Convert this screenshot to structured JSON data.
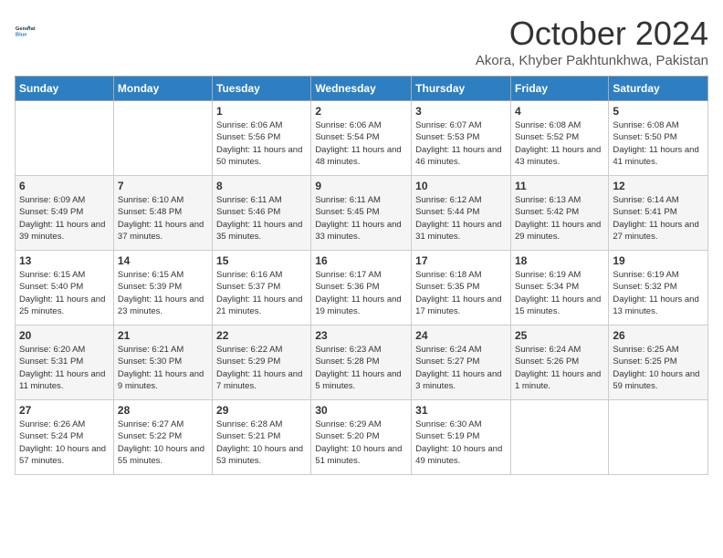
{
  "header": {
    "logo_line1": "General",
    "logo_line2": "Blue",
    "month": "October 2024",
    "location": "Akora, Khyber Pakhtunkhwa, Pakistan"
  },
  "days_of_week": [
    "Sunday",
    "Monday",
    "Tuesday",
    "Wednesday",
    "Thursday",
    "Friday",
    "Saturday"
  ],
  "weeks": [
    [
      {
        "day": "",
        "sunrise": "",
        "sunset": "",
        "daylight": ""
      },
      {
        "day": "",
        "sunrise": "",
        "sunset": "",
        "daylight": ""
      },
      {
        "day": "1",
        "sunrise": "Sunrise: 6:06 AM",
        "sunset": "Sunset: 5:56 PM",
        "daylight": "Daylight: 11 hours and 50 minutes."
      },
      {
        "day": "2",
        "sunrise": "Sunrise: 6:06 AM",
        "sunset": "Sunset: 5:54 PM",
        "daylight": "Daylight: 11 hours and 48 minutes."
      },
      {
        "day": "3",
        "sunrise": "Sunrise: 6:07 AM",
        "sunset": "Sunset: 5:53 PM",
        "daylight": "Daylight: 11 hours and 46 minutes."
      },
      {
        "day": "4",
        "sunrise": "Sunrise: 6:08 AM",
        "sunset": "Sunset: 5:52 PM",
        "daylight": "Daylight: 11 hours and 43 minutes."
      },
      {
        "day": "5",
        "sunrise": "Sunrise: 6:08 AM",
        "sunset": "Sunset: 5:50 PM",
        "daylight": "Daylight: 11 hours and 41 minutes."
      }
    ],
    [
      {
        "day": "6",
        "sunrise": "Sunrise: 6:09 AM",
        "sunset": "Sunset: 5:49 PM",
        "daylight": "Daylight: 11 hours and 39 minutes."
      },
      {
        "day": "7",
        "sunrise": "Sunrise: 6:10 AM",
        "sunset": "Sunset: 5:48 PM",
        "daylight": "Daylight: 11 hours and 37 minutes."
      },
      {
        "day": "8",
        "sunrise": "Sunrise: 6:11 AM",
        "sunset": "Sunset: 5:46 PM",
        "daylight": "Daylight: 11 hours and 35 minutes."
      },
      {
        "day": "9",
        "sunrise": "Sunrise: 6:11 AM",
        "sunset": "Sunset: 5:45 PM",
        "daylight": "Daylight: 11 hours and 33 minutes."
      },
      {
        "day": "10",
        "sunrise": "Sunrise: 6:12 AM",
        "sunset": "Sunset: 5:44 PM",
        "daylight": "Daylight: 11 hours and 31 minutes."
      },
      {
        "day": "11",
        "sunrise": "Sunrise: 6:13 AM",
        "sunset": "Sunset: 5:42 PM",
        "daylight": "Daylight: 11 hours and 29 minutes."
      },
      {
        "day": "12",
        "sunrise": "Sunrise: 6:14 AM",
        "sunset": "Sunset: 5:41 PM",
        "daylight": "Daylight: 11 hours and 27 minutes."
      }
    ],
    [
      {
        "day": "13",
        "sunrise": "Sunrise: 6:15 AM",
        "sunset": "Sunset: 5:40 PM",
        "daylight": "Daylight: 11 hours and 25 minutes."
      },
      {
        "day": "14",
        "sunrise": "Sunrise: 6:15 AM",
        "sunset": "Sunset: 5:39 PM",
        "daylight": "Daylight: 11 hours and 23 minutes."
      },
      {
        "day": "15",
        "sunrise": "Sunrise: 6:16 AM",
        "sunset": "Sunset: 5:37 PM",
        "daylight": "Daylight: 11 hours and 21 minutes."
      },
      {
        "day": "16",
        "sunrise": "Sunrise: 6:17 AM",
        "sunset": "Sunset: 5:36 PM",
        "daylight": "Daylight: 11 hours and 19 minutes."
      },
      {
        "day": "17",
        "sunrise": "Sunrise: 6:18 AM",
        "sunset": "Sunset: 5:35 PM",
        "daylight": "Daylight: 11 hours and 17 minutes."
      },
      {
        "day": "18",
        "sunrise": "Sunrise: 6:19 AM",
        "sunset": "Sunset: 5:34 PM",
        "daylight": "Daylight: 11 hours and 15 minutes."
      },
      {
        "day": "19",
        "sunrise": "Sunrise: 6:19 AM",
        "sunset": "Sunset: 5:32 PM",
        "daylight": "Daylight: 11 hours and 13 minutes."
      }
    ],
    [
      {
        "day": "20",
        "sunrise": "Sunrise: 6:20 AM",
        "sunset": "Sunset: 5:31 PM",
        "daylight": "Daylight: 11 hours and 11 minutes."
      },
      {
        "day": "21",
        "sunrise": "Sunrise: 6:21 AM",
        "sunset": "Sunset: 5:30 PM",
        "daylight": "Daylight: 11 hours and 9 minutes."
      },
      {
        "day": "22",
        "sunrise": "Sunrise: 6:22 AM",
        "sunset": "Sunset: 5:29 PM",
        "daylight": "Daylight: 11 hours and 7 minutes."
      },
      {
        "day": "23",
        "sunrise": "Sunrise: 6:23 AM",
        "sunset": "Sunset: 5:28 PM",
        "daylight": "Daylight: 11 hours and 5 minutes."
      },
      {
        "day": "24",
        "sunrise": "Sunrise: 6:24 AM",
        "sunset": "Sunset: 5:27 PM",
        "daylight": "Daylight: 11 hours and 3 minutes."
      },
      {
        "day": "25",
        "sunrise": "Sunrise: 6:24 AM",
        "sunset": "Sunset: 5:26 PM",
        "daylight": "Daylight: 11 hours and 1 minute."
      },
      {
        "day": "26",
        "sunrise": "Sunrise: 6:25 AM",
        "sunset": "Sunset: 5:25 PM",
        "daylight": "Daylight: 10 hours and 59 minutes."
      }
    ],
    [
      {
        "day": "27",
        "sunrise": "Sunrise: 6:26 AM",
        "sunset": "Sunset: 5:24 PM",
        "daylight": "Daylight: 10 hours and 57 minutes."
      },
      {
        "day": "28",
        "sunrise": "Sunrise: 6:27 AM",
        "sunset": "Sunset: 5:22 PM",
        "daylight": "Daylight: 10 hours and 55 minutes."
      },
      {
        "day": "29",
        "sunrise": "Sunrise: 6:28 AM",
        "sunset": "Sunset: 5:21 PM",
        "daylight": "Daylight: 10 hours and 53 minutes."
      },
      {
        "day": "30",
        "sunrise": "Sunrise: 6:29 AM",
        "sunset": "Sunset: 5:20 PM",
        "daylight": "Daylight: 10 hours and 51 minutes."
      },
      {
        "day": "31",
        "sunrise": "Sunrise: 6:30 AM",
        "sunset": "Sunset: 5:19 PM",
        "daylight": "Daylight: 10 hours and 49 minutes."
      },
      {
        "day": "",
        "sunrise": "",
        "sunset": "",
        "daylight": ""
      },
      {
        "day": "",
        "sunrise": "",
        "sunset": "",
        "daylight": ""
      }
    ]
  ]
}
